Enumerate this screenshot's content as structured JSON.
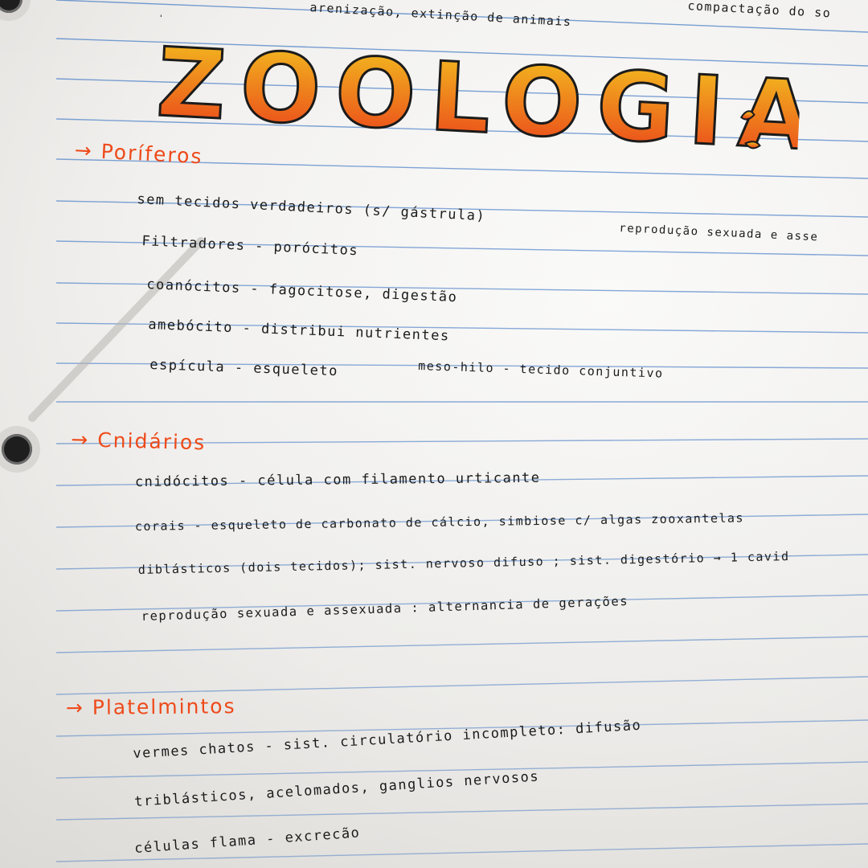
{
  "title": "ZOOLOGIA",
  "top_fragment_left": "arenização, extinção de animais",
  "top_fragment_right": "compactação do so",
  "sections": [
    {
      "heading": "Poríferos",
      "lines": [
        "sem tecidos verdadeiros (s/ gástrula)",
        "Filtradores - porócitos",
        "coanócitos - fagocitose, digestão",
        "amebócito - distribui nutrientes",
        "espícula - esqueleto"
      ],
      "side_notes": [
        "reprodução sexuada e asse",
        "meso-hilo - tecido conjuntivo"
      ]
    },
    {
      "heading": "Cnidários",
      "lines": [
        "cnidócitos - célula com filamento urticante",
        "corais - esqueleto de carbonato de cálcio, simbiose c/ algas zooxantelas",
        "diblásticos (dois tecidos); sist. nervoso difuso ; sist. digestório → 1 cavid",
        "reprodução sexuada e assexuada : alternancia de gerações"
      ]
    },
    {
      "heading": "Platelmintos",
      "lines": [
        "vermes chatos - sist. circulatório incompleto: difusão",
        "triblásticos, acelomados, ganglios nervosos",
        "células flama - excrecão"
      ]
    }
  ],
  "colors": {
    "heading": "#ee4a1a",
    "rule": "#4a7fc7",
    "ink": "#1b1b1b",
    "title_top": "#f3c61f",
    "title_bottom": "#ea3d1a"
  }
}
